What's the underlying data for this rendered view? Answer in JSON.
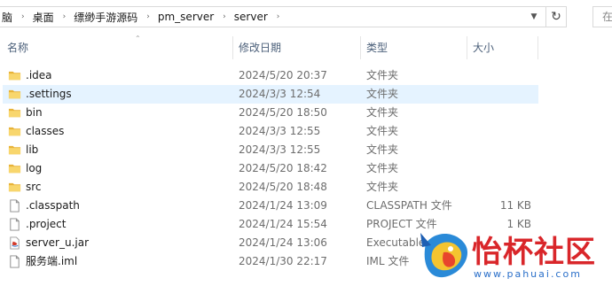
{
  "breadcrumb": {
    "items": [
      "脑",
      "桌面",
      "缥缈手游源码",
      "pm_server",
      "server"
    ]
  },
  "search": {
    "placeholder": "在"
  },
  "columns": {
    "name": "名称",
    "date": "修改日期",
    "type": "类型",
    "size": "大小"
  },
  "files": [
    {
      "name": ".idea",
      "date": "2024/5/20 20:37",
      "type": "文件夹",
      "size": "",
      "icon": "folder-icon"
    },
    {
      "name": ".settings",
      "date": "2024/3/3 12:54",
      "type": "文件夹",
      "size": "",
      "icon": "folder-icon"
    },
    {
      "name": "bin",
      "date": "2024/5/20 18:50",
      "type": "文件夹",
      "size": "",
      "icon": "folder-icon"
    },
    {
      "name": "classes",
      "date": "2024/3/3 12:55",
      "type": "文件夹",
      "size": "",
      "icon": "folder-icon"
    },
    {
      "name": "lib",
      "date": "2024/3/3 12:55",
      "type": "文件夹",
      "size": "",
      "icon": "folder-icon"
    },
    {
      "name": "log",
      "date": "2024/5/20 18:42",
      "type": "文件夹",
      "size": "",
      "icon": "folder-icon"
    },
    {
      "name": "src",
      "date": "2024/5/20 18:48",
      "type": "文件夹",
      "size": "",
      "icon": "folder-icon"
    },
    {
      "name": ".classpath",
      "date": "2024/1/24 13:09",
      "type": "CLASSPATH 文件",
      "size": "11 KB",
      "icon": "file-icon"
    },
    {
      "name": ".project",
      "date": "2024/1/24 15:54",
      "type": "PROJECT 文件",
      "size": "1 KB",
      "icon": "file-icon"
    },
    {
      "name": "server_u.jar",
      "date": "2024/1/24 13:06",
      "type": "Executable",
      "size": "",
      "icon": "jar-icon"
    },
    {
      "name": "服务端.iml",
      "date": "2024/1/30 22:17",
      "type": "IML 文件",
      "size": "",
      "icon": "file-icon"
    }
  ],
  "watermark": {
    "title": "怡杯社区",
    "url": "www.pahuai.com"
  },
  "colors": {
    "selected_row": "#e5f3ff",
    "folder": "#f0c040",
    "header_text": "#4c607a",
    "watermark_red": "#d9262a"
  }
}
